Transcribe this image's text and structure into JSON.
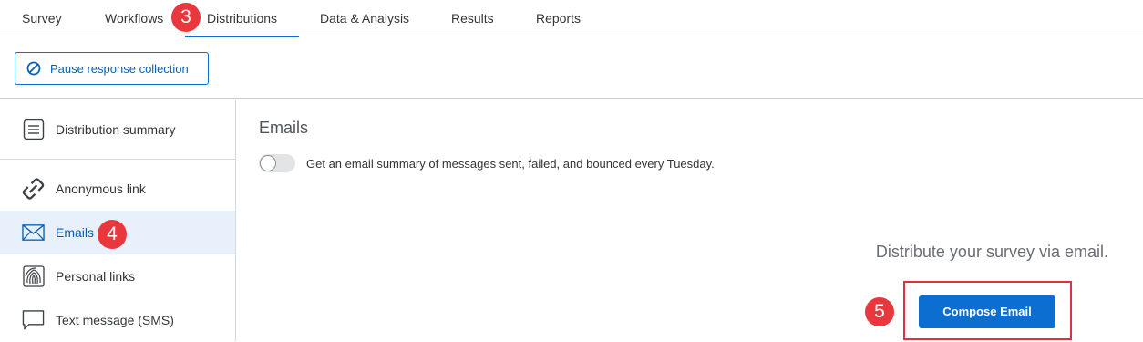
{
  "topnav": {
    "tabs": [
      {
        "label": "Survey"
      },
      {
        "label": "Workflows"
      },
      {
        "label": "Distributions"
      },
      {
        "label": "Data & Analysis"
      },
      {
        "label": "Results"
      },
      {
        "label": "Reports"
      }
    ],
    "active_tab": "Distributions"
  },
  "toolbar": {
    "pause_label": "Pause response collection",
    "pause_icon": "block-icon"
  },
  "sidebar": {
    "items": [
      {
        "label": "Distribution summary",
        "icon": "list-icon"
      },
      {
        "label": "Anonymous link",
        "icon": "link-icon"
      },
      {
        "label": "Emails",
        "icon": "envelope-icon"
      },
      {
        "label": "Personal links",
        "icon": "fingerprint-icon"
      },
      {
        "label": "Text message (SMS)",
        "icon": "chat-bubble-icon"
      }
    ],
    "active_item": "Emails"
  },
  "main": {
    "title": "Emails",
    "summary_toggle_label": "Get an email summary of messages sent, failed, and bounced every Tuesday.",
    "summary_toggle_on": false,
    "distribute_text": "Distribute your survey via email.",
    "compose_label": "Compose Email"
  },
  "annotations": {
    "badge_tab": "3",
    "badge_sidebar": "4",
    "badge_compose": "5"
  },
  "colors": {
    "accent": "#0b6ed0",
    "badge": "#e8373d",
    "highlight": "#d9353b",
    "active_bg": "#e8f1fb"
  }
}
